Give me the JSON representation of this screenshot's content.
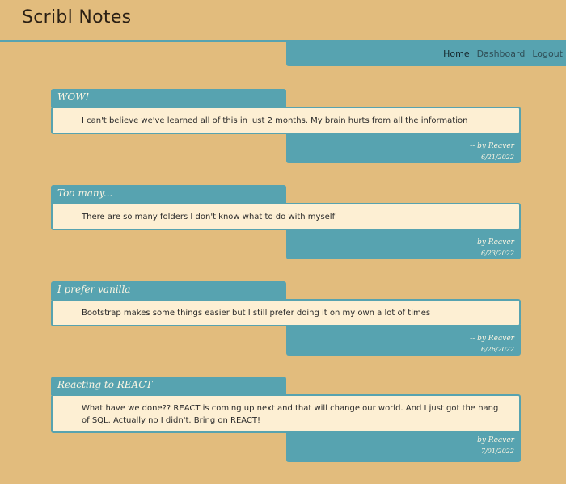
{
  "app": {
    "title": "Scribl Notes"
  },
  "nav": {
    "items": [
      {
        "label": "Home",
        "active": true
      },
      {
        "label": "Dashboard",
        "active": false
      },
      {
        "label": "Logout",
        "active": false
      }
    ]
  },
  "notes": [
    {
      "title": "WOW!",
      "body": "I can't believe we've learned all of this in just 2 months. My brain hurts from all the information",
      "author": "-- by Reaver",
      "date": "6/21/2022"
    },
    {
      "title": "Too many...",
      "body": "There are so many folders I don't know what to do with myself",
      "author": "-- by Reaver",
      "date": "6/23/2022"
    },
    {
      "title": "I prefer vanilla",
      "body": "Bootstrap makes some things easier but I still prefer doing it on my own a lot of times",
      "author": "-- by Reaver",
      "date": "6/26/2022"
    },
    {
      "title": "Reacting to REACT",
      "body": "What have we done?? REACT is coming up next and that will change our world. And I just got the hang of SQL. Actually no I didn't. Bring on REACT!",
      "author": "-- by Reaver",
      "date": "7/01/2022"
    }
  ],
  "colors": {
    "background": "#e2bc7d",
    "accent": "#57a3b0",
    "card": "#fdefd3"
  }
}
